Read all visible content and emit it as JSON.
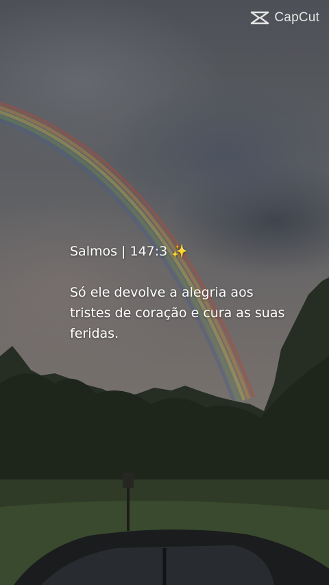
{
  "watermark": {
    "label": "CapCut",
    "icon": "capcut-logo-icon"
  },
  "caption": {
    "reference": "Salmos | 147:3 ✨",
    "verse": "Só ele devolve a alegria aos tristes de coração e cura as suas feridas."
  }
}
